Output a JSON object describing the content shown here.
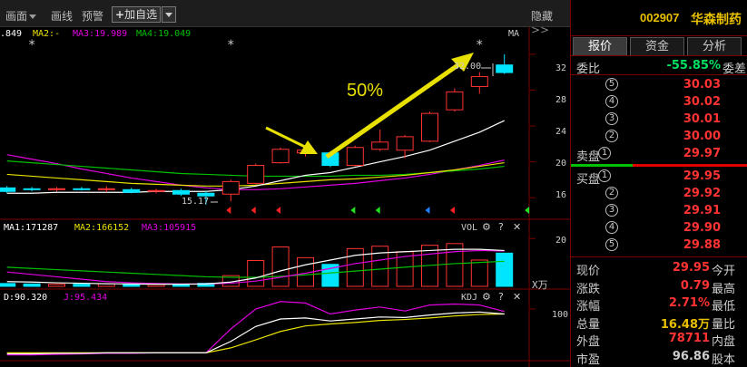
{
  "toolbar": {
    "items": [
      "画面",
      "画线",
      "预警"
    ],
    "add_watch": "加自选",
    "hide": "隐藏"
  },
  "ma_legend": {
    "ma1": ".849",
    "ma2": "MA2:-",
    "ma3": "MA3:19.989",
    "ma4": "MA4:19.049",
    "indicator": "MA"
  },
  "price_axis": [
    "32",
    "28",
    "24",
    "20",
    "16"
  ],
  "annotations": {
    "percent": "50%",
    "high_label": "32.00",
    "low_label": "15.17"
  },
  "volume_panel": {
    "ma1": "MA1:171287",
    "ma2": "MA2:166152",
    "ma3": "MA3:105915",
    "title": "VOL",
    "axis_top": "20",
    "axis_unit": "X万"
  },
  "kdj_panel": {
    "d": "D:90.320",
    "j": "J:95.434",
    "title": "KDJ",
    "axis_top": "100"
  },
  "stock": {
    "code": "002907",
    "name": "华森制药"
  },
  "tabs": [
    "报价",
    "资金",
    "分析"
  ],
  "order_book": {
    "weibi_label": "委比",
    "weibi_value": "-55.85%",
    "weicha_label": "委差",
    "sell_label": "卖盘",
    "buy_label": "买盘",
    "sell": [
      {
        "level": "⑤",
        "price": "30.03"
      },
      {
        "level": "④",
        "price": "30.02"
      },
      {
        "level": "③",
        "price": "30.01"
      },
      {
        "level": "②",
        "price": "30.00"
      },
      {
        "level": "①",
        "price": "29.97"
      }
    ],
    "buy": [
      {
        "level": "①",
        "price": "29.95"
      },
      {
        "level": "②",
        "price": "29.92"
      },
      {
        "level": "③",
        "price": "29.91"
      },
      {
        "level": "④",
        "price": "29.90"
      },
      {
        "level": "⑤",
        "price": "29.88"
      }
    ]
  },
  "quote": [
    {
      "label": "现价",
      "value": "29.95",
      "extra": "今开",
      "color": "#ff3333"
    },
    {
      "label": "涨跌",
      "value": "0.79",
      "extra": "最高",
      "color": "#ff3333"
    },
    {
      "label": "涨幅",
      "value": "2.71%",
      "extra": "最低",
      "color": "#ff3333"
    },
    {
      "label": "总量",
      "value": "16.48万",
      "extra": "量比",
      "color": "#e8c000"
    },
    {
      "label": "外盘",
      "value": "78711",
      "extra": "内盘",
      "color": "#ff3333"
    },
    {
      "label": "市盈",
      "value": "96.86",
      "extra": "股本",
      "color": "#cccccc"
    }
  ],
  "colors": {
    "up": "#ff3333",
    "down": "#00e5ff",
    "ma_white": "#ffffff",
    "ma_yellow": "#e8e000",
    "ma_magenta": "#e000e0",
    "ma_green": "#00c000"
  },
  "chart_data": {
    "type": "candlestick",
    "price_range": [
      14,
      34
    ],
    "candles": [
      {
        "o": 17.1,
        "c": 16.7,
        "h": 17.3,
        "l": 16.5
      },
      {
        "o": 17.0,
        "c": 16.9,
        "h": 17.2,
        "l": 16.7
      },
      {
        "o": 16.9,
        "c": 17.0,
        "h": 17.2,
        "l": 16.7
      },
      {
        "o": 17.0,
        "c": 16.9,
        "h": 17.2,
        "l": 16.8
      },
      {
        "o": 16.9,
        "c": 17.0,
        "h": 17.3,
        "l": 16.6
      },
      {
        "o": 16.9,
        "c": 16.6,
        "h": 17.1,
        "l": 16.5
      },
      {
        "o": 16.7,
        "c": 16.8,
        "h": 17.0,
        "l": 16.5
      },
      {
        "o": 16.8,
        "c": 16.4,
        "h": 17.0,
        "l": 16.2
      },
      {
        "o": 16.5,
        "c": 16.2,
        "h": 16.7,
        "l": 15.2
      },
      {
        "o": 16.4,
        "c": 17.8,
        "h": 18.0,
        "l": 15.6
      },
      {
        "o": 17.6,
        "c": 19.6,
        "h": 19.8,
        "l": 17.5
      },
      {
        "o": 19.9,
        "c": 21.4,
        "h": 21.6,
        "l": 19.8
      },
      {
        "o": 21.0,
        "c": 21.3,
        "h": 21.6,
        "l": 20.6
      },
      {
        "o": 21.0,
        "c": 19.6,
        "h": 21.2,
        "l": 19.4
      },
      {
        "o": 19.6,
        "c": 21.6,
        "h": 21.8,
        "l": 19.5
      },
      {
        "o": 21.4,
        "c": 22.2,
        "h": 23.6,
        "l": 21.2
      },
      {
        "o": 21.3,
        "c": 22.8,
        "h": 23.0,
        "l": 20.4
      },
      {
        "o": 22.3,
        "c": 25.4,
        "h": 25.6,
        "l": 22.2
      },
      {
        "o": 25.8,
        "c": 27.8,
        "h": 28.2,
        "l": 25.6
      },
      {
        "o": 28.4,
        "c": 29.5,
        "h": 30.0,
        "l": 27.6
      },
      {
        "o": 30.8,
        "c": 29.95,
        "h": 32.0,
        "l": 29.8
      }
    ],
    "ma_white": [
      16.5,
      16.5,
      16.6,
      16.6,
      16.6,
      16.6,
      16.7,
      16.7,
      16.7,
      16.9,
      17.3,
      17.9,
      18.5,
      18.8,
      19.4,
      20.0,
      20.6,
      21.3,
      22.3,
      23.3,
      24.6
    ],
    "ma_yellow": [
      18.6,
      18.4,
      18.2,
      18.0,
      17.8,
      17.6,
      17.5,
      17.4,
      17.3,
      17.3,
      17.4,
      17.6,
      17.8,
      18.0,
      18.1,
      18.3,
      18.5,
      18.8,
      19.1,
      19.5,
      19.9
    ],
    "ma_green": [
      20.1,
      19.9,
      19.7,
      19.5,
      19.3,
      19.1,
      18.9,
      18.7,
      18.6,
      18.5,
      18.4,
      18.4,
      18.4,
      18.4,
      18.5,
      18.5,
      18.6,
      18.8,
      19.0,
      19.2,
      19.5
    ],
    "ma_magenta": [
      20.8,
      20.3,
      19.8,
      19.2,
      18.7,
      18.2,
      17.8,
      17.4,
      17.1,
      16.9,
      16.9,
      17.0,
      17.2,
      17.4,
      17.6,
      17.9,
      18.2,
      18.6,
      19.1,
      19.6,
      20.2
    ],
    "volume_range": [
      0,
      22
    ],
    "volumes": [
      1.2,
      1.0,
      0.9,
      0.9,
      1.1,
      0.8,
      0.8,
      0.8,
      1.3,
      4.5,
      10.8,
      16.5,
      12.0,
      9.2,
      15.8,
      16.8,
      14.5,
      17.2,
      17.9,
      11.0,
      13.9
    ],
    "vol_ma_white": [
      2.0,
      1.8,
      1.5,
      1.3,
      1.1,
      1.0,
      0.9,
      0.9,
      1.0,
      1.8,
      3.5,
      6.5,
      9.0,
      11.0,
      13.0,
      14.0,
      14.5,
      15.0,
      15.5,
      15.5,
      15.0
    ],
    "vol_ma_magenta": [
      6.0,
      5.0,
      4.0,
      3.0,
      2.0,
      1.5,
      1.2,
      1.0,
      1.0,
      1.3,
      2.2,
      3.8,
      5.5,
      7.5,
      9.5,
      11.0,
      12.5,
      13.5,
      14.5,
      15.0,
      14.8
    ],
    "vol_ma_green": [
      8.0,
      7.5,
      7.0,
      6.5,
      6.0,
      5.5,
      5.0,
      4.5,
      4.0,
      3.8,
      3.8,
      4.2,
      4.8,
      5.6,
      6.4,
      7.2,
      8.0,
      8.8,
      9.5,
      10.0,
      10.5
    ],
    "kdj_range": [
      0,
      120
    ],
    "k": [
      10,
      10,
      11,
      11,
      12,
      12,
      12,
      12,
      12,
      35,
      65,
      80,
      82,
      76,
      80,
      84,
      83,
      88,
      92,
      94,
      90
    ],
    "d": [
      12,
      12,
      12,
      12,
      12,
      12,
      12,
      12,
      12,
      22,
      38,
      55,
      66,
      70,
      73,
      77,
      79,
      82,
      86,
      89,
      90
    ],
    "j": [
      8,
      8,
      9,
      10,
      11,
      11,
      12,
      12,
      12,
      60,
      100,
      115,
      112,
      90,
      98,
      104,
      96,
      108,
      110,
      108,
      95
    ],
    "markers": {
      "stars_at": [
        1,
        9,
        19
      ],
      "red_flags_at": [
        9,
        10,
        11,
        18
      ],
      "green_flags_at": [
        14,
        15,
        21
      ],
      "blue_flags_at": [
        17
      ]
    }
  }
}
